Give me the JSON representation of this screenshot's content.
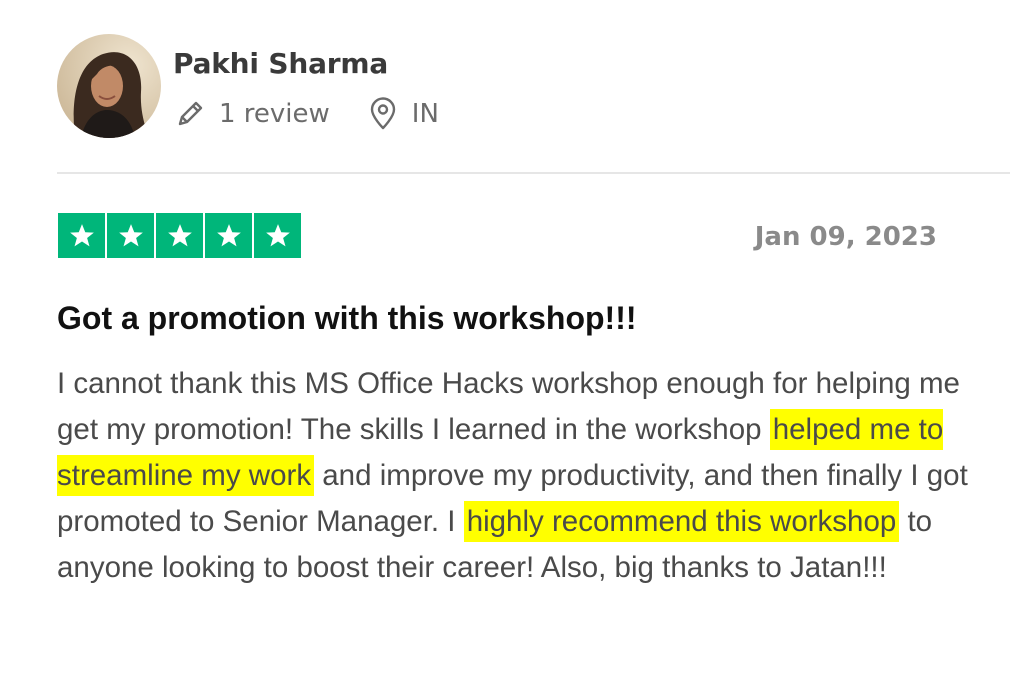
{
  "reviewer": {
    "name": "Pakhi Sharma",
    "review_count": "1 review",
    "country": "IN",
    "avatar_icon": "profile-photo"
  },
  "rating": {
    "stars": 5,
    "max_stars": 5,
    "star_color": "#00b67a"
  },
  "review": {
    "date": "Jan 09, 2023",
    "title": "Got a promotion with this workshop!!!",
    "body": {
      "part1": "I cannot thank this MS Office Hacks workshop enough for helping me get my promotion! The skills I learned in the workshop ",
      "highlight1": "helped me to streamline my work",
      "part2": " and improve my productivity, and then finally I got promoted to Senior Manager. I ",
      "highlight2": "highly recommend this workshop",
      "part3": " to anyone looking to boost their career! Also, big thanks to Jatan!!!"
    },
    "highlight_color": "#ffff00"
  }
}
